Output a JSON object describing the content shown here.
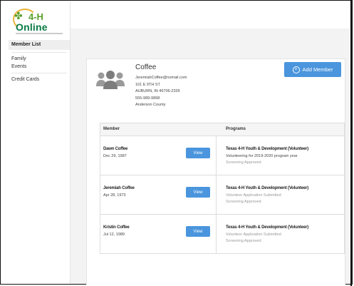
{
  "logo": {
    "line1": "4-H",
    "line2": "Online"
  },
  "sidebar": {
    "selected": "Member List",
    "items": [
      "Family",
      "Events"
    ],
    "items2": [
      "Credit Cards"
    ]
  },
  "family": {
    "name": "Coffee",
    "email": "JeremiahCoffee@nomail.com",
    "address1": "101 E 9TH ST",
    "address2": "AUBURN, IN 46706-2335",
    "phone": "555-989-9898",
    "county": "Anderson County"
  },
  "add_member_label": "Add Member",
  "table": {
    "col_member": "Member",
    "col_programs": "Programs",
    "view_label": "View",
    "rows": [
      {
        "name": "Dawn Coffee",
        "dob": "Dec 29, 1987",
        "program": "Texas 4-H Youth & Development (Volunteer)",
        "line1": "Volunteering for 2019-2020 program year",
        "line2": "Screening Approved"
      },
      {
        "name": "Jeremiah Coffee",
        "dob": "Apr 28, 1973",
        "program": "Texas 4-H Youth & Development (Volunteer)",
        "line1": "Volunteer Application Submitted",
        "line2": "Screening Approved"
      },
      {
        "name": "Kristin Coffee",
        "dob": "Jul 12, 1989",
        "program": "Texas 4-H Youth & Development (Volunteer)",
        "line1": "Volunteer Application Submitted",
        "line2": "Screening Approved"
      }
    ]
  },
  "colors": {
    "brand_green": "#5aa02c",
    "button_blue": "#4a95dd"
  }
}
